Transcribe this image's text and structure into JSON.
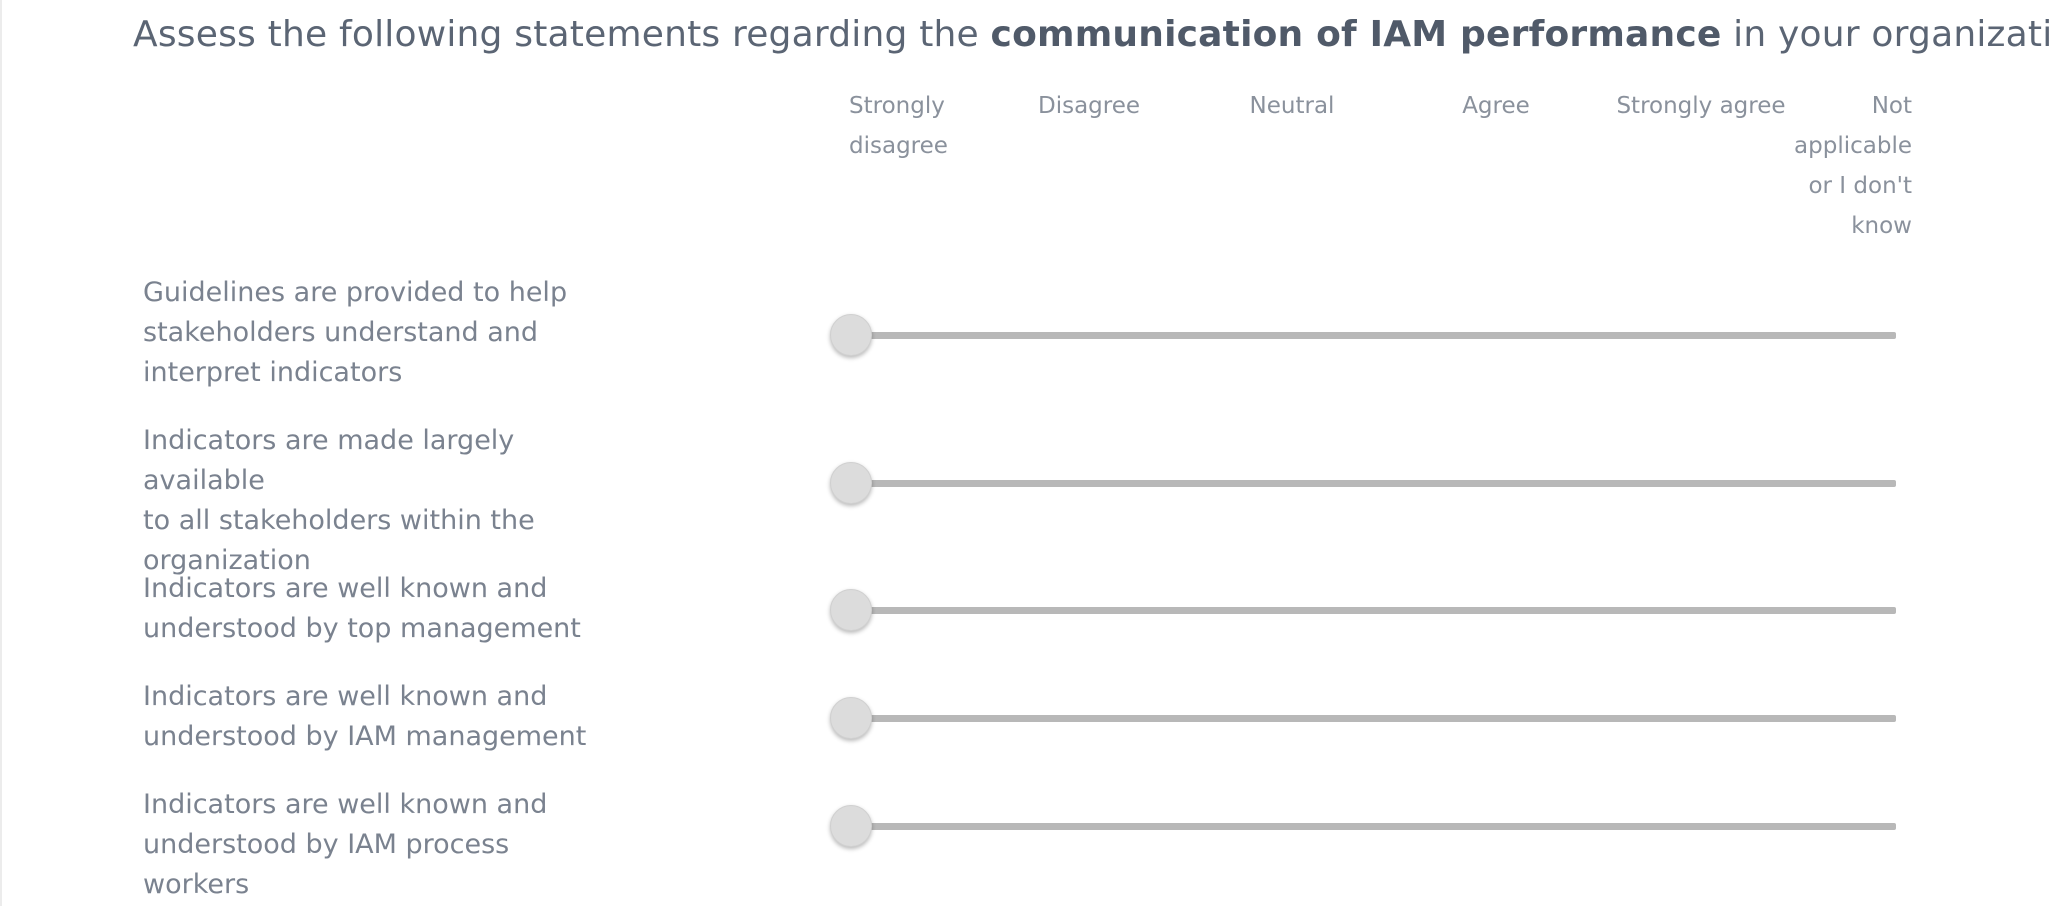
{
  "question": {
    "prefix": "Assess the following statements regarding the ",
    "emphasis": "communication of IAM performance",
    "suffix": " in your organization."
  },
  "scale": {
    "labels": [
      [
        "Strongly",
        "disagree"
      ],
      [
        "Disagree"
      ],
      [
        "Neutral"
      ],
      [
        "Agree"
      ],
      [
        "Strongly agree"
      ],
      [
        "Not",
        "applicable",
        "or I don't",
        "know"
      ]
    ]
  },
  "statements": [
    {
      "lines": [
        "Guidelines are provided to help",
        "stakeholders understand and",
        "interpret indicators"
      ],
      "value": 0
    },
    {
      "lines": [
        "Indicators are made largely available",
        "to all stakeholders within the",
        "organization"
      ],
      "value": 0
    },
    {
      "lines": [
        "Indicators are well known and",
        "understood by top management"
      ],
      "value": 0
    },
    {
      "lines": [
        "Indicators are well known and",
        "understood by IAM management"
      ],
      "value": 0
    },
    {
      "lines": [
        "Indicators are well known and",
        "understood by IAM process workers"
      ],
      "value": 0
    }
  ],
  "colors": {
    "track": "#b8b8b8",
    "thumb": "#dcdcdc",
    "text": "#7a828f"
  }
}
